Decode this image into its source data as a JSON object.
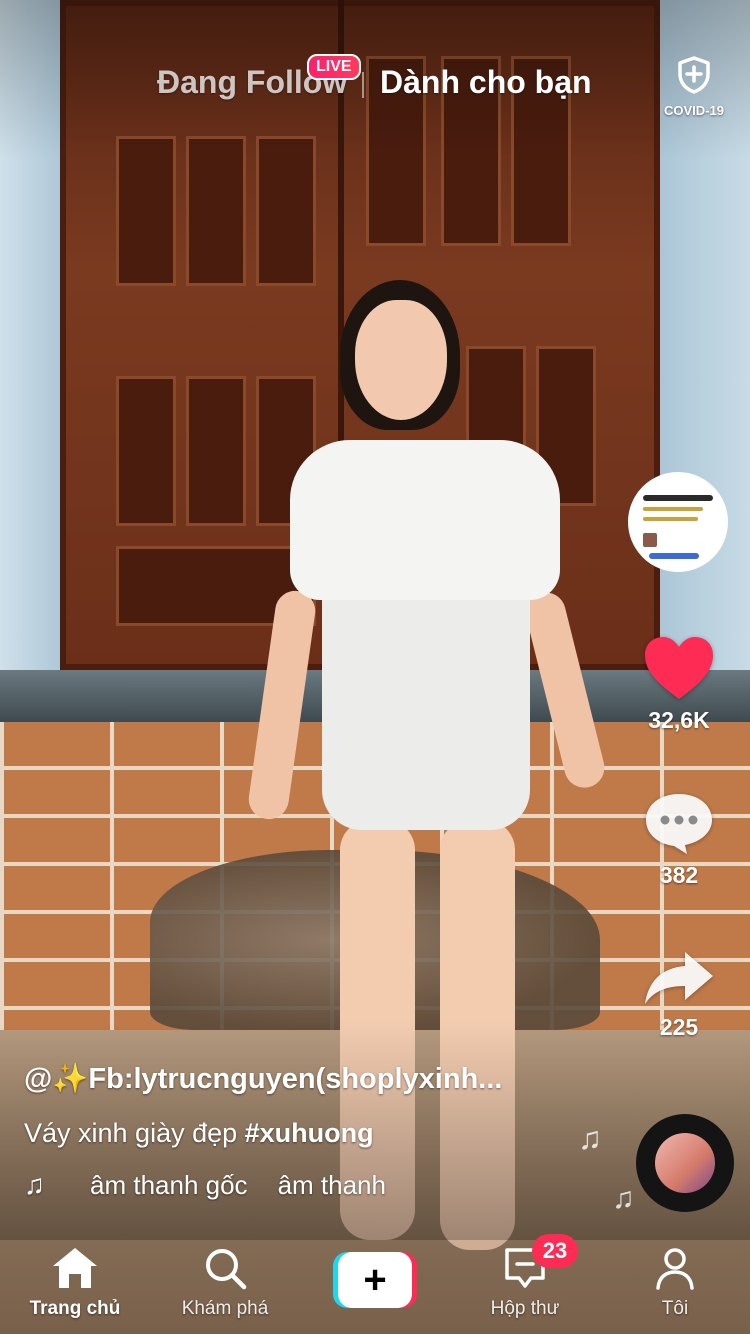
{
  "top_tabs": {
    "following": "Đang Follow",
    "live_badge": "LIVE",
    "for_you": "Dành cho bạn"
  },
  "covid": {
    "label": "COVID-19",
    "icon": "shield-icon"
  },
  "actions": {
    "likes": "32,6K",
    "comments": "382",
    "shares": "225",
    "like_color": "#fe2c55"
  },
  "caption": {
    "author": "@✨Fb:lytrucnguyen(shoplyxinh...",
    "description_text": "Váy xinh giày đẹp ",
    "hashtag": "#xuhuong",
    "music_1": "âm thanh gốc",
    "music_2": "âm thanh"
  },
  "nav": {
    "home": "Trang chủ",
    "discover": "Khám phá",
    "create": "+",
    "inbox": "Hộp thư",
    "inbox_badge": "23",
    "profile": "Tôi"
  }
}
